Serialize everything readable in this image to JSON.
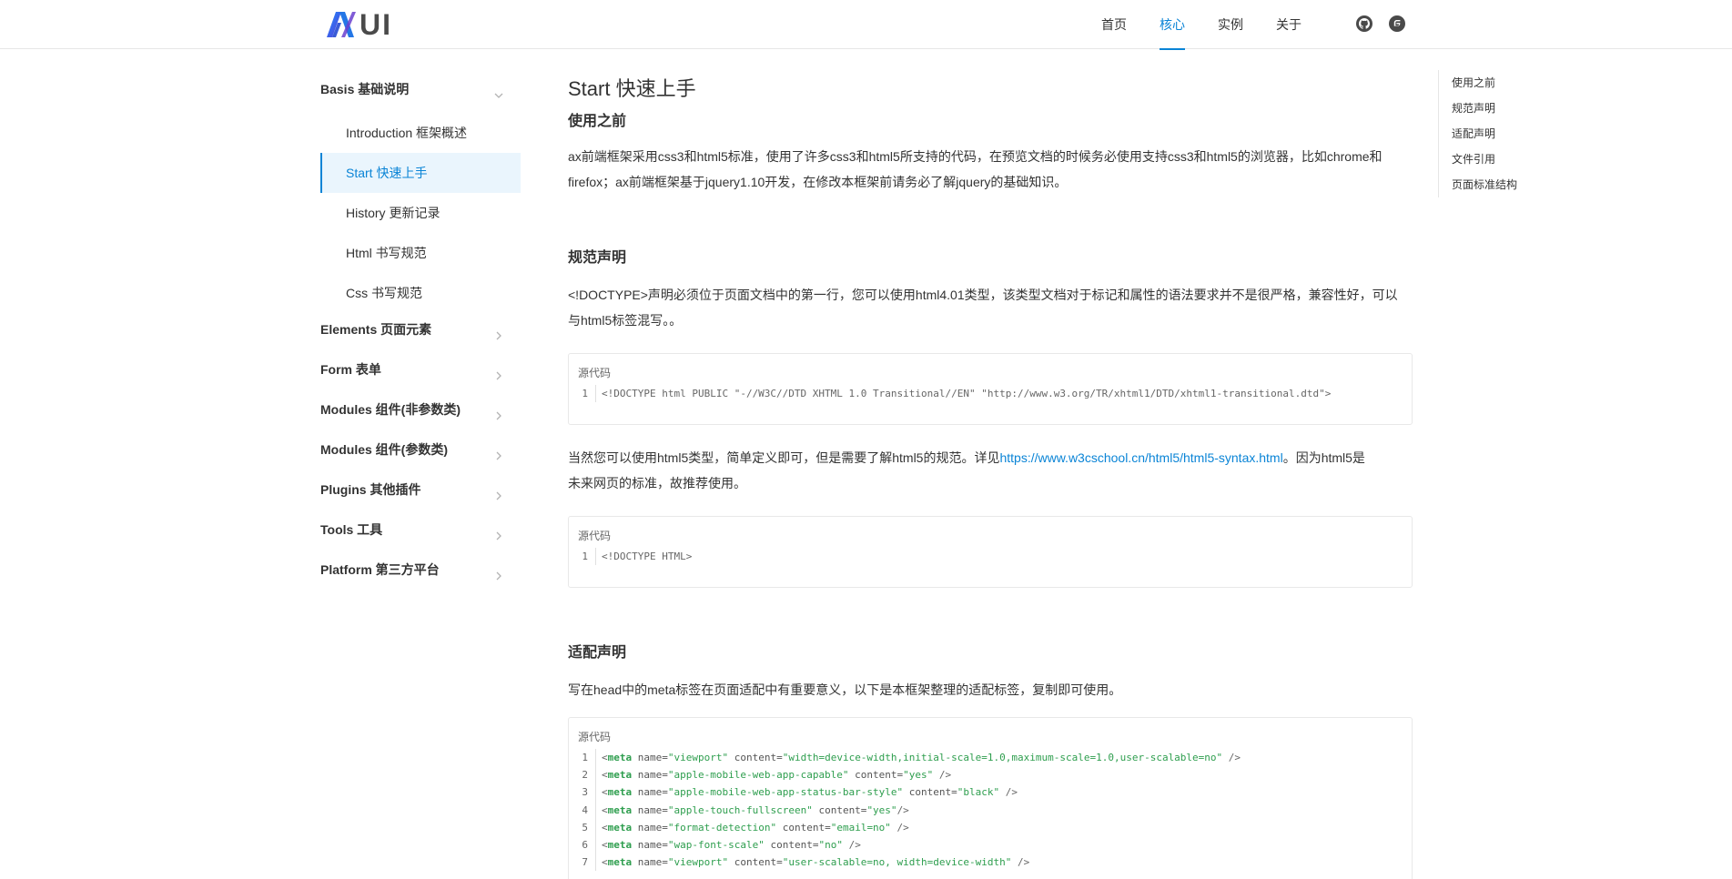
{
  "header": {
    "logo_text": "UI",
    "nav": [
      "首页",
      "核心",
      "实例",
      "关于"
    ],
    "active_nav": 1,
    "icons": [
      "github-icon",
      "gitee-icon"
    ]
  },
  "sidebar": {
    "groups": [
      {
        "title": "Basis 基础说明",
        "expanded": true,
        "items": [
          "Introduction 框架概述",
          "Start 快速上手",
          "History 更新记录",
          "Html 书写规范",
          "Css 书写规范"
        ],
        "active_item": 1
      },
      {
        "title": "Elements 页面元素",
        "expanded": false
      },
      {
        "title": "Form 表单",
        "expanded": false
      },
      {
        "title": "Modules 组件(非参数类)",
        "expanded": false
      },
      {
        "title": "Modules 组件(参数类)",
        "expanded": false
      },
      {
        "title": "Plugins 其他插件",
        "expanded": false
      },
      {
        "title": "Tools 工具",
        "expanded": false
      },
      {
        "title": "Platform 第三方平台",
        "expanded": false
      }
    ]
  },
  "main": {
    "title": "Start 快速上手",
    "s1": {
      "title": "使用之前",
      "p1": "ax前端框架采用css3和html5标准，使用了许多css3和html5所支持的代码，在预览文档的时候务必使用支持css3和html5的浏览器，比如chrome和",
      "p2": "firefox；ax前端框架基于jquery1.10开发，在修改本框架前请务必了解jquery的基础知识。"
    },
    "s2": {
      "title": "规范声明",
      "p1": "<!DOCTYPE>声明必须位于页面文档中的第一行，您可以使用html4.01类型，该类型文档对于标记和属性的语法要求并不是很严格，兼容性好，可以",
      "p2": "与html5标签混写。。",
      "code_label": "源代码",
      "code1": "<!DOCTYPE html PUBLIC \"-//W3C//DTD XHTML 1.0 Transitional//EN\" \"http://www.w3.org/TR/xhtml1/DTD/xhtml1-transitional.dtd\">",
      "p3_before": "当然您可以使用html5类型，简单定义即可，但是需要了解html5的规范。详见",
      "p3_link": "https://www.w3cschool.cn/html5/html5-syntax.html",
      "p3_after": "。因为html5是",
      "p4": "未来网页的标准，故推荐使用。",
      "code2": "<!DOCTYPE HTML>"
    },
    "s3": {
      "title": "适配声明",
      "p1": "写在head中的meta标签在页面适配中有重要意义，以下是本框架整理的适配标签，复制即可使用。",
      "code_label": "源代码",
      "meta_lines": [
        {
          "n": "1",
          "name": "\"viewport\"",
          "content": "\"width=device-width,initial-scale=1.0,maximum-scale=1.0,user-scalable=no\"",
          "end": " />"
        },
        {
          "n": "2",
          "name": "\"apple-mobile-web-app-capable\"",
          "content": "\"yes\"",
          "end": " />"
        },
        {
          "n": "3",
          "name": "\"apple-mobile-web-app-status-bar-style\"",
          "content": "\"black\"",
          "end": " />"
        },
        {
          "n": "4",
          "name": "\"apple-touch-fullscreen\"",
          "content": "\"yes\"",
          "end": "/>"
        },
        {
          "n": "5",
          "name": "\"format-detection\"",
          "content": "\"email=no\"",
          "end": " />"
        },
        {
          "n": "6",
          "name": "\"wap-font-scale\"",
          "content": "\"no\"",
          "end": " />"
        },
        {
          "n": "7",
          "name": "\"viewport\"",
          "content": "\"user-scalable=no, width=device-width\"",
          "end": " />"
        }
      ]
    }
  },
  "toc": [
    "使用之前",
    "规范声明",
    "适配声明",
    "文件引用",
    "页面标准结构"
  ],
  "colors": {
    "accent": "#0a84d6",
    "active_bg": "#eaf5fd",
    "code_green": "#2e9e4e"
  }
}
